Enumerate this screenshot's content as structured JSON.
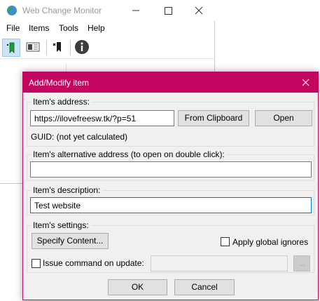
{
  "main_window": {
    "title": "Web Change Monitor",
    "menu": [
      "File",
      "Items",
      "Tools",
      "Help"
    ],
    "toolbar": {
      "icons": [
        "add-item-icon",
        "edit-item-icon",
        "delete-item-icon",
        "info-icon"
      ]
    }
  },
  "dialog": {
    "title": "Add/Modify item",
    "address": {
      "group_label": "Item's address:",
      "value": "https://ilovefreesw.tk/?p=51",
      "from_clipboard_label": "From Clipboard",
      "open_label": "Open",
      "guid_text": "GUID: (not yet calculated)"
    },
    "alt_address": {
      "group_label": "Item's alternative address (to open on double click):",
      "value": ""
    },
    "description": {
      "group_label": "Item's description:",
      "value": "Test website"
    },
    "settings": {
      "group_label": "Item's settings:",
      "specify_content_label": "Specify Content...",
      "apply_global_ignores_label": "Apply global ignores",
      "apply_global_ignores_checked": false,
      "issue_command_label": "Issue command on update:",
      "issue_command_checked": false,
      "command_value": "",
      "browse_label": "..."
    },
    "ok_label": "OK",
    "cancel_label": "Cancel"
  },
  "colors": {
    "accent": "#c3065f",
    "focus_border": "#0078d7",
    "toolbar_active": "#cce4f7"
  }
}
